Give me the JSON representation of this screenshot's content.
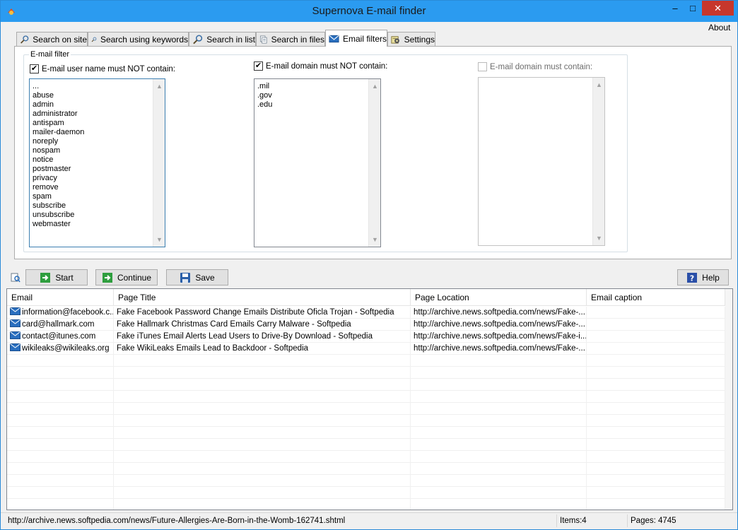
{
  "window": {
    "title": "Supernova E-mail finder",
    "about_label": "About"
  },
  "tabs": [
    {
      "label": "Search on site",
      "icon": "magnifier-icon"
    },
    {
      "label": "Search using keywords",
      "icon": "magnifier-icon"
    },
    {
      "label": "Search in list",
      "icon": "magnifier-icon"
    },
    {
      "label": "Search in files",
      "icon": "documents-icon"
    },
    {
      "label": "Email filters",
      "icon": "envelope-icon",
      "active": true
    },
    {
      "label": "Settings",
      "icon": "settings-icon"
    }
  ],
  "filters": {
    "group_label": "E-mail filter",
    "username": {
      "label": "E-mail user name must NOT contain:",
      "checked": true,
      "items": [
        "...",
        "abuse",
        "admin",
        "administrator",
        "antispam",
        "mailer-daemon",
        "noreply",
        "nospam",
        "notice",
        "postmaster",
        "privacy",
        "remove",
        "spam",
        "subscribe",
        "unsubscribe",
        "webmaster"
      ]
    },
    "domain_not": {
      "label": "E-mail domain must NOT contain:",
      "checked": true,
      "items": [
        ".mil",
        ".gov",
        ".edu"
      ]
    },
    "domain_must": {
      "label": "E-mail domain must  contain:",
      "checked": false,
      "items": []
    }
  },
  "toolbar": {
    "start_label": "Start",
    "continue_label": "Continue",
    "save_label": "Save",
    "help_label": "Help"
  },
  "results": {
    "columns": [
      "Email",
      "Page Title",
      "Page Location",
      "Email caption"
    ],
    "rows": [
      {
        "email": "information@facebook.c...",
        "title": "Fake Facebook Password Change Emails Distribute Oficla Trojan - Softpedia",
        "location": "http://archive.news.softpedia.com/news/Fake-...",
        "caption": ""
      },
      {
        "email": "card@hallmark.com",
        "title": "Fake Hallmark Christmas Card Emails Carry Malware - Softpedia",
        "location": "http://archive.news.softpedia.com/news/Fake-...",
        "caption": ""
      },
      {
        "email": "contact@itunes.com",
        "title": "Fake iTunes Email Alerts Lead Users to Drive-By Download - Softpedia",
        "location": "http://archive.news.softpedia.com/news/Fake-i...",
        "caption": ""
      },
      {
        "email": "wikileaks@wikileaks.org",
        "title": "Fake WikiLeaks Emails Lead to Backdoor - Softpedia",
        "location": "http://archive.news.softpedia.com/news/Fake-...",
        "caption": ""
      }
    ]
  },
  "status": {
    "url": "http://archive.news.softpedia.com/news/Future-Allergies-Are-Born-in-the-Womb-162741.shtml",
    "items": "Items:4",
    "pages": "Pages: 4745"
  },
  "colors": {
    "titlebar": "#2b9bf0",
    "close": "#c7372c",
    "focus_border": "#3c7fb1"
  }
}
